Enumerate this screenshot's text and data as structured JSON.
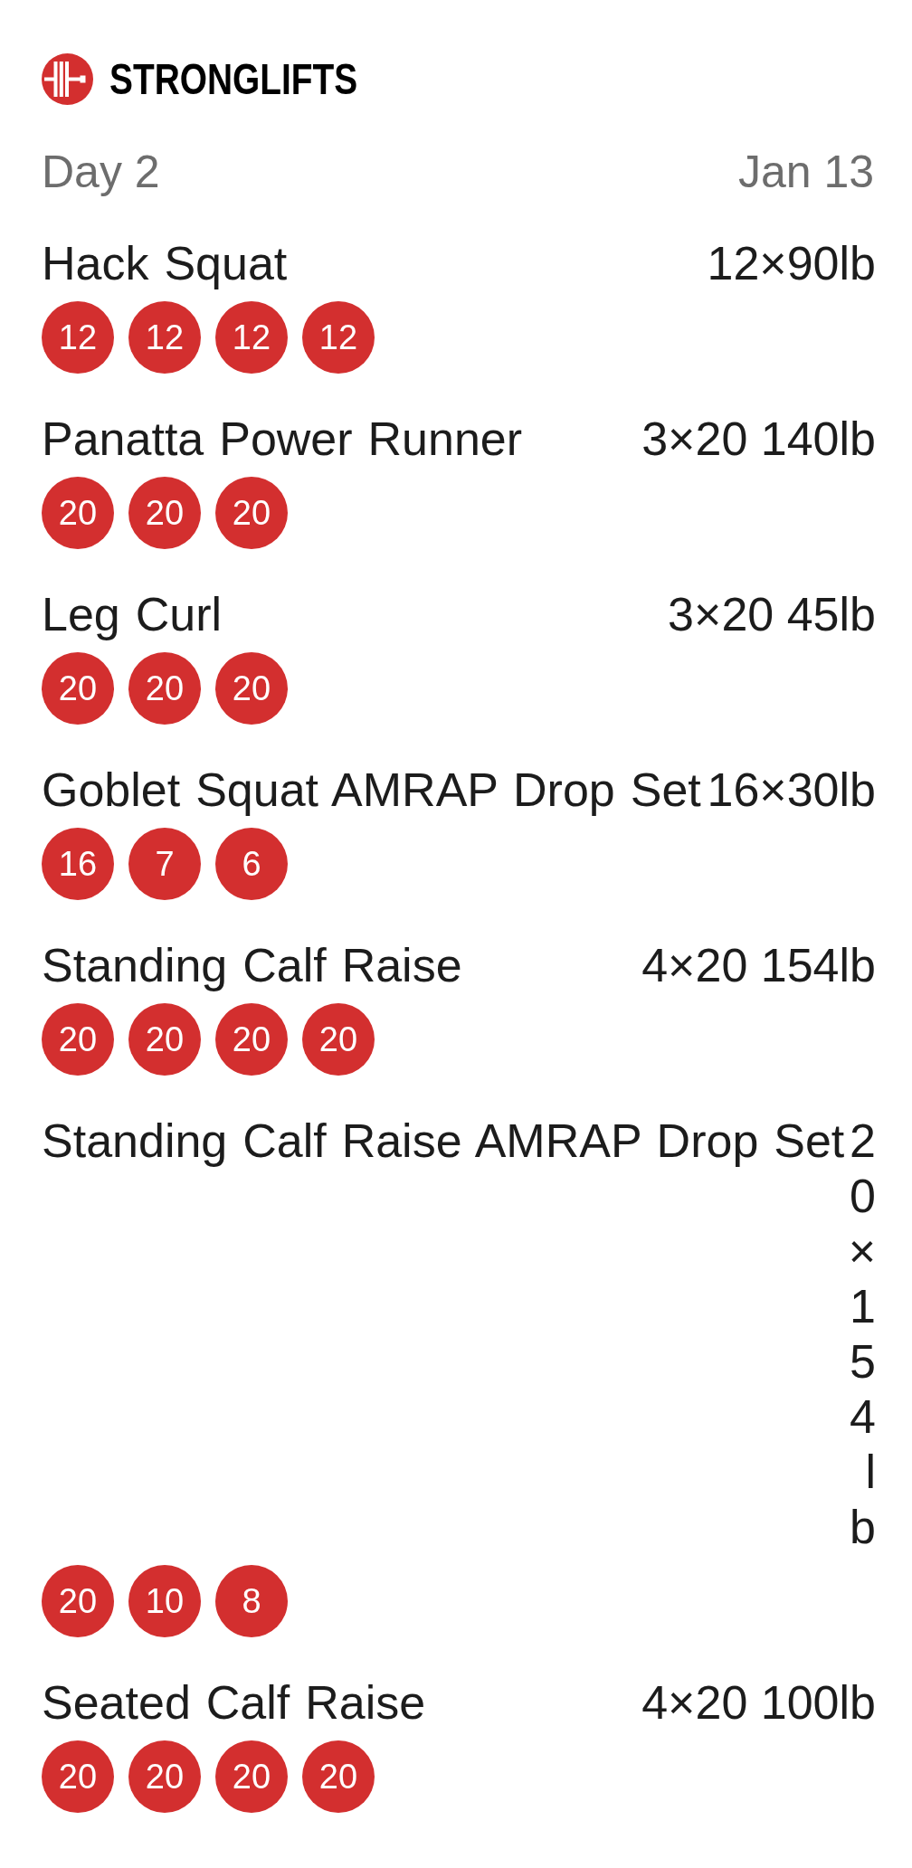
{
  "header": {
    "brand": "STRONGLIFTS"
  },
  "workout": {
    "day": "Day 2",
    "date": "Jan 13"
  },
  "exercises": [
    {
      "name": "Hack Squat",
      "target": "12×90lb",
      "sets": [
        "12",
        "12",
        "12",
        "12"
      ]
    },
    {
      "name": "Panatta Power Runner",
      "target": "3×20 140lb",
      "sets": [
        "20",
        "20",
        "20"
      ]
    },
    {
      "name": "Leg Curl",
      "target": "3×20 45lb",
      "sets": [
        "20",
        "20",
        "20"
      ]
    },
    {
      "name": "Goblet Squat AMRAP Drop Set",
      "target": "16×30lb",
      "sets": [
        "16",
        "7",
        "6"
      ]
    },
    {
      "name": "Standing Calf Raise",
      "target": "4×20 154lb",
      "sets": [
        "20",
        "20",
        "20",
        "20"
      ]
    },
    {
      "name": "Standing Calf Raise AMRAP Drop Set",
      "target": "20×154lb",
      "sets": [
        "20",
        "10",
        "8"
      ]
    },
    {
      "name": "Seated Calf Raise",
      "target": "4×20 100lb",
      "sets": [
        "20",
        "20",
        "20",
        "20"
      ]
    }
  ]
}
